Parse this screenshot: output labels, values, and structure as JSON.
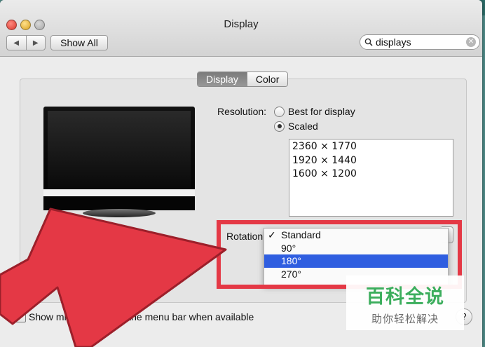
{
  "window": {
    "title": "Display"
  },
  "toolbar": {
    "back_glyph": "◀",
    "forward_glyph": "▶",
    "show_all_label": "Show All"
  },
  "search": {
    "value": "displays",
    "icon": "search-icon",
    "clear_icon": "clear-icon"
  },
  "tabs": [
    {
      "label": "Display",
      "selected": true
    },
    {
      "label": "Color",
      "selected": false
    }
  ],
  "resolution": {
    "label": "Resolution:",
    "options": [
      {
        "label": "Best for display",
        "selected": false
      },
      {
        "label": "Scaled",
        "selected": true
      }
    ],
    "list": [
      "2360 × 1770",
      "1920 × 1440",
      "1600 × 1200"
    ]
  },
  "rotation": {
    "label": "Rotation",
    "menu": [
      {
        "label": "Standard",
        "checked": true,
        "highlighted": false
      },
      {
        "label": "90°",
        "checked": false,
        "highlighted": false
      },
      {
        "label": "180°",
        "checked": false,
        "highlighted": true
      },
      {
        "label": "270°",
        "checked": false,
        "highlighted": false
      }
    ],
    "check_glyph": "✓"
  },
  "mirror": {
    "label": "Show mirro",
    "label_tail": "ns in the menu bar when available",
    "checked": true
  },
  "help": {
    "label": "?"
  },
  "watermark": {
    "main": "百科全说",
    "sub": "助你轻松解决"
  },
  "colors": {
    "highlight_border": "#e43845",
    "arrow_fill": "#e43845",
    "menu_selection": "#2f5ee0",
    "watermark_green": "#3cae5d"
  }
}
